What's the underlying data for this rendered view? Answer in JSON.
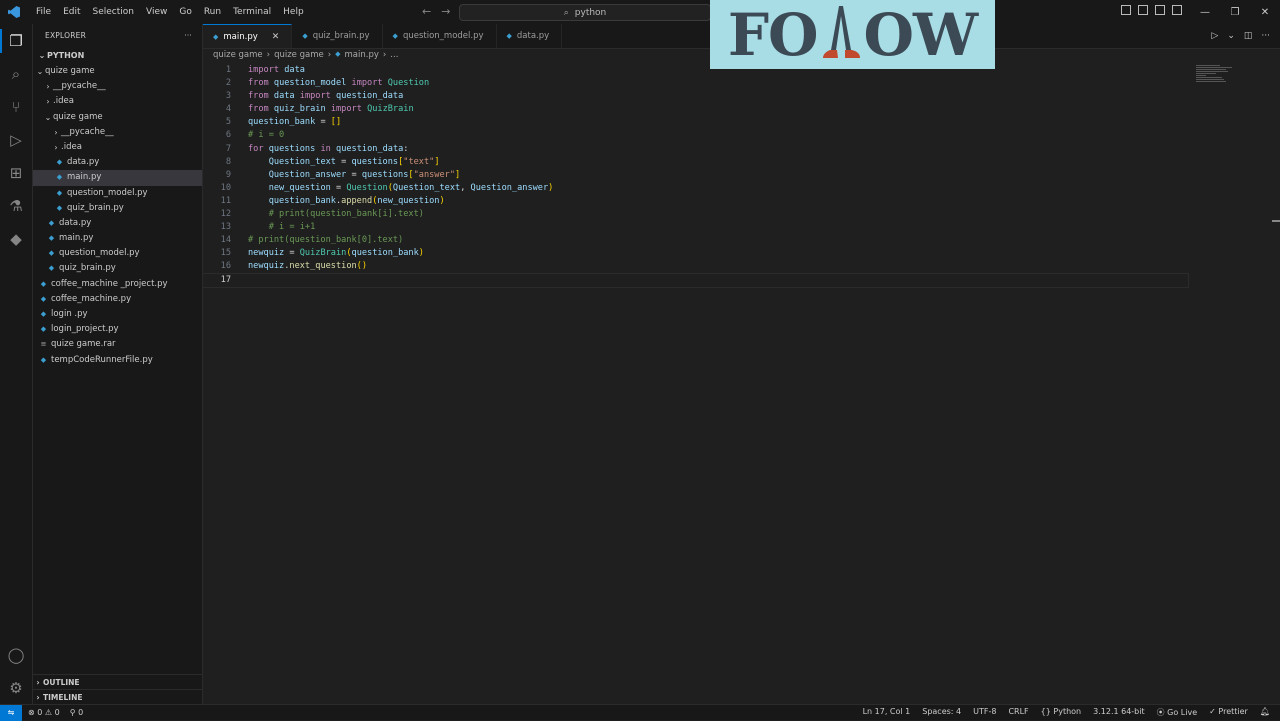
{
  "menu": [
    "File",
    "Edit",
    "Selection",
    "View",
    "Go",
    "Run",
    "Terminal",
    "Help"
  ],
  "search_box": "python",
  "overlay": {
    "text_a": "FO",
    "text_b": "OW"
  },
  "explorer": {
    "header": "EXPLORER",
    "more": "···",
    "root": "PYTHON",
    "tree": [
      {
        "label": "quize game",
        "depth": 1,
        "chev": "⌄",
        "folder": true
      },
      {
        "label": "__pycache__",
        "depth": 2,
        "chev": "›",
        "folder": true
      },
      {
        "label": ".idea",
        "depth": 2,
        "chev": "›",
        "folder": true
      },
      {
        "label": "quize game",
        "depth": 2,
        "chev": "⌄",
        "folder": true
      },
      {
        "label": "__pycache__",
        "depth": 3,
        "chev": "›",
        "folder": true
      },
      {
        "label": ".idea",
        "depth": 3,
        "chev": "›",
        "folder": true
      },
      {
        "label": "data.py",
        "depth": 3,
        "icon": "python"
      },
      {
        "label": "main.py",
        "depth": 3,
        "icon": "python",
        "selected": true
      },
      {
        "label": "question_model.py",
        "depth": 3,
        "icon": "python"
      },
      {
        "label": "quiz_brain.py",
        "depth": 3,
        "icon": "python"
      },
      {
        "label": "data.py",
        "depth": 2,
        "icon": "python"
      },
      {
        "label": "main.py",
        "depth": 2,
        "icon": "python"
      },
      {
        "label": "question_model.py",
        "depth": 2,
        "icon": "python"
      },
      {
        "label": "quiz_brain.py",
        "depth": 2,
        "icon": "python"
      },
      {
        "label": "coffee_machine _project.py",
        "depth": 1,
        "icon": "python"
      },
      {
        "label": "coffee_machine.py",
        "depth": 1,
        "icon": "python"
      },
      {
        "label": "login .py",
        "depth": 1,
        "icon": "python"
      },
      {
        "label": "login_project.py",
        "depth": 1,
        "icon": "python"
      },
      {
        "label": "quize game.rar",
        "depth": 1,
        "icon": "rar"
      },
      {
        "label": "tempCodeRunnerFile.py",
        "depth": 1,
        "icon": "python"
      }
    ],
    "outline": "OUTLINE",
    "timeline": "TIMELINE"
  },
  "tabs": [
    {
      "label": "main.py",
      "active": true
    },
    {
      "label": "quiz_brain.py"
    },
    {
      "label": "question_model.py"
    },
    {
      "label": "data.py"
    }
  ],
  "breadcrumb": [
    "quize game",
    "quize game",
    "main.py",
    "..."
  ],
  "code_lines": [
    [
      [
        "kw",
        "import"
      ],
      [
        "t",
        " "
      ],
      [
        "var",
        "data"
      ]
    ],
    [
      [
        "kw",
        "from"
      ],
      [
        "t",
        " "
      ],
      [
        "var",
        "question_model"
      ],
      [
        "t",
        " "
      ],
      [
        "kw",
        "import"
      ],
      [
        "t",
        " "
      ],
      [
        "ty",
        "Question"
      ]
    ],
    [
      [
        "kw",
        "from"
      ],
      [
        "t",
        " "
      ],
      [
        "var",
        "data"
      ],
      [
        "t",
        " "
      ],
      [
        "kw",
        "import"
      ],
      [
        "t",
        " "
      ],
      [
        "var",
        "question_data"
      ]
    ],
    [
      [
        "kw",
        "from"
      ],
      [
        "t",
        " "
      ],
      [
        "var",
        "quiz_brain"
      ],
      [
        "t",
        " "
      ],
      [
        "kw",
        "import"
      ],
      [
        "t",
        " "
      ],
      [
        "ty",
        "QuizBrain"
      ]
    ],
    [
      [
        "var",
        "question_bank"
      ],
      [
        "t",
        " = "
      ],
      [
        "br",
        "[]"
      ]
    ],
    [
      [
        "cm",
        "# i = 0"
      ]
    ],
    [
      [
        "kw",
        "for"
      ],
      [
        "t",
        " "
      ],
      [
        "var",
        "questions"
      ],
      [
        "t",
        " "
      ],
      [
        "kw",
        "in"
      ],
      [
        "t",
        " "
      ],
      [
        "var",
        "question_data"
      ],
      [
        "t",
        ":"
      ]
    ],
    [
      [
        "t",
        "    "
      ],
      [
        "var",
        "Question_text"
      ],
      [
        "t",
        " = "
      ],
      [
        "var",
        "questions"
      ],
      [
        "br",
        "["
      ],
      [
        "str",
        "\"text\""
      ],
      [
        "br",
        "]"
      ]
    ],
    [
      [
        "t",
        "    "
      ],
      [
        "var",
        "Question_answer"
      ],
      [
        "t",
        " = "
      ],
      [
        "var",
        "questions"
      ],
      [
        "br",
        "["
      ],
      [
        "str",
        "\"answer\""
      ],
      [
        "br",
        "]"
      ]
    ],
    [
      [
        "t",
        "    "
      ],
      [
        "var",
        "new_question"
      ],
      [
        "t",
        " = "
      ],
      [
        "ty",
        "Question"
      ],
      [
        "br",
        "("
      ],
      [
        "var",
        "Question_text"
      ],
      [
        "t",
        ", "
      ],
      [
        "var",
        "Question_answer"
      ],
      [
        "br",
        ")"
      ]
    ],
    [
      [
        "t",
        "    "
      ],
      [
        "var",
        "question_bank"
      ],
      [
        "t",
        "."
      ],
      [
        "fn",
        "append"
      ],
      [
        "br",
        "("
      ],
      [
        "var",
        "new_question"
      ],
      [
        "br",
        ")"
      ]
    ],
    [
      [
        "t",
        "    "
      ],
      [
        "cm",
        "# print(question_bank[i].text)"
      ]
    ],
    [
      [
        "t",
        "    "
      ],
      [
        "cm",
        "# i = i+1"
      ]
    ],
    [
      [
        "cm",
        "# print(question_bank[0].text)"
      ]
    ],
    [
      [
        "var",
        "newquiz"
      ],
      [
        "t",
        " = "
      ],
      [
        "ty",
        "QuizBrain"
      ],
      [
        "br",
        "("
      ],
      [
        "var",
        "question_bank"
      ],
      [
        "br",
        ")"
      ]
    ],
    [
      [
        "var",
        "newquiz"
      ],
      [
        "t",
        "."
      ],
      [
        "fn",
        "next_question"
      ],
      [
        "br",
        "()"
      ]
    ],
    []
  ],
  "status": {
    "errors": "0",
    "warnings": "0",
    "ports": "0",
    "position": "Ln 17, Col 1",
    "spaces": "Spaces: 4",
    "encoding": "UTF-8",
    "eol": "CRLF",
    "language": "Python",
    "interpreter": "3.12.1 64-bit",
    "golive": "Go Live",
    "prettier": "Prettier"
  }
}
